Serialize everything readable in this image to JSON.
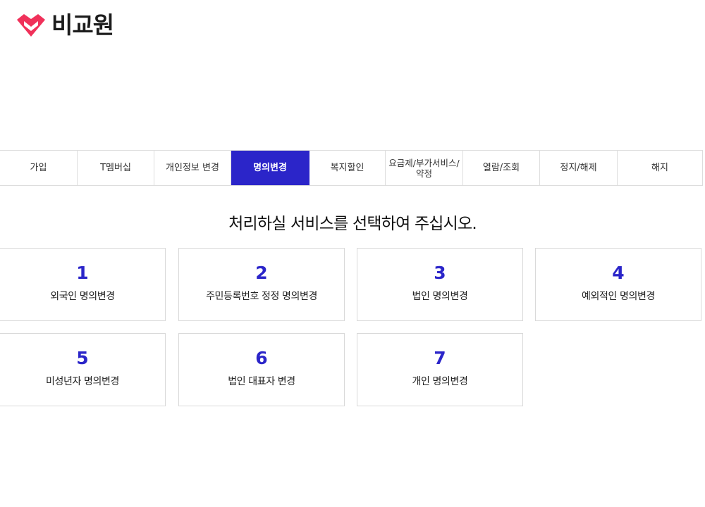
{
  "header": {
    "brand_name": "비교원",
    "brand_color": "#f0315a"
  },
  "tabs": [
    {
      "label": "가입",
      "active": false
    },
    {
      "label": "T멤버십",
      "active": false
    },
    {
      "label": "개인정보 변경",
      "active": false
    },
    {
      "label": "명의변경",
      "active": true
    },
    {
      "label": "복지할인",
      "active": false
    },
    {
      "label": "요금제/부가서비스/약정",
      "active": false
    },
    {
      "label": "열람/조회",
      "active": false
    },
    {
      "label": "정지/해제",
      "active": false
    },
    {
      "label": "해지",
      "active": false
    }
  ],
  "main": {
    "heading": "처리하실 서비스를 선택하여 주십시오.",
    "options": [
      {
        "number": "1",
        "label": "외국인 명의변경"
      },
      {
        "number": "2",
        "label": "주민등록번호 정정 명의변경"
      },
      {
        "number": "3",
        "label": "법인 명의변경"
      },
      {
        "number": "4",
        "label": "예외적인 명의변경"
      },
      {
        "number": "5",
        "label": "미성년자 명의변경"
      },
      {
        "number": "6",
        "label": "법인 대표자 변경"
      },
      {
        "number": "7",
        "label": "개인 명의변경"
      }
    ]
  },
  "colors": {
    "accent": "#2b25c9",
    "border": "#dddddd"
  }
}
